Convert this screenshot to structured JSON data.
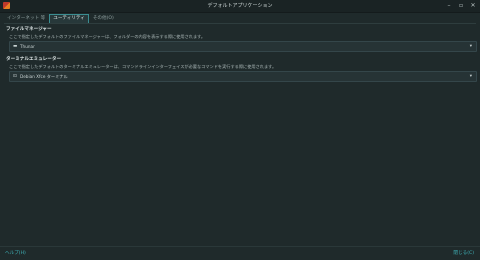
{
  "window": {
    "title": "デフォルトアプリケーション",
    "minimize": "–",
    "maximize": "▫",
    "close": "✕"
  },
  "tabs": [
    {
      "label": "インターネット 等",
      "active": false
    },
    {
      "label": "ユーティリティ",
      "active": true
    },
    {
      "label": "その他(O)",
      "active": false
    }
  ],
  "file_manager": {
    "title": "ファイルマネージャー",
    "description": "ここで指定したデフォルトのファイルマネージャーは、フォルダーの内容を表示する際に使用されます。",
    "selected": "Thunar",
    "icon": "folder-icon"
  },
  "terminal": {
    "title": "ターミナルエミュレーター",
    "description": "ここで指定したデフォルトのターミナルエミュレーターは、コマンドラインインターフェイスが必要なコマンドを実行する際に使用されます。",
    "selected": "Debian Xfce ターミナル",
    "icon": "terminal-icon"
  },
  "footer": {
    "help_label": "ヘルプ(H)",
    "close_label": "閉じる(C)"
  },
  "colors": {
    "background": "#1f2a2b",
    "accent": "#3fb3b9"
  }
}
